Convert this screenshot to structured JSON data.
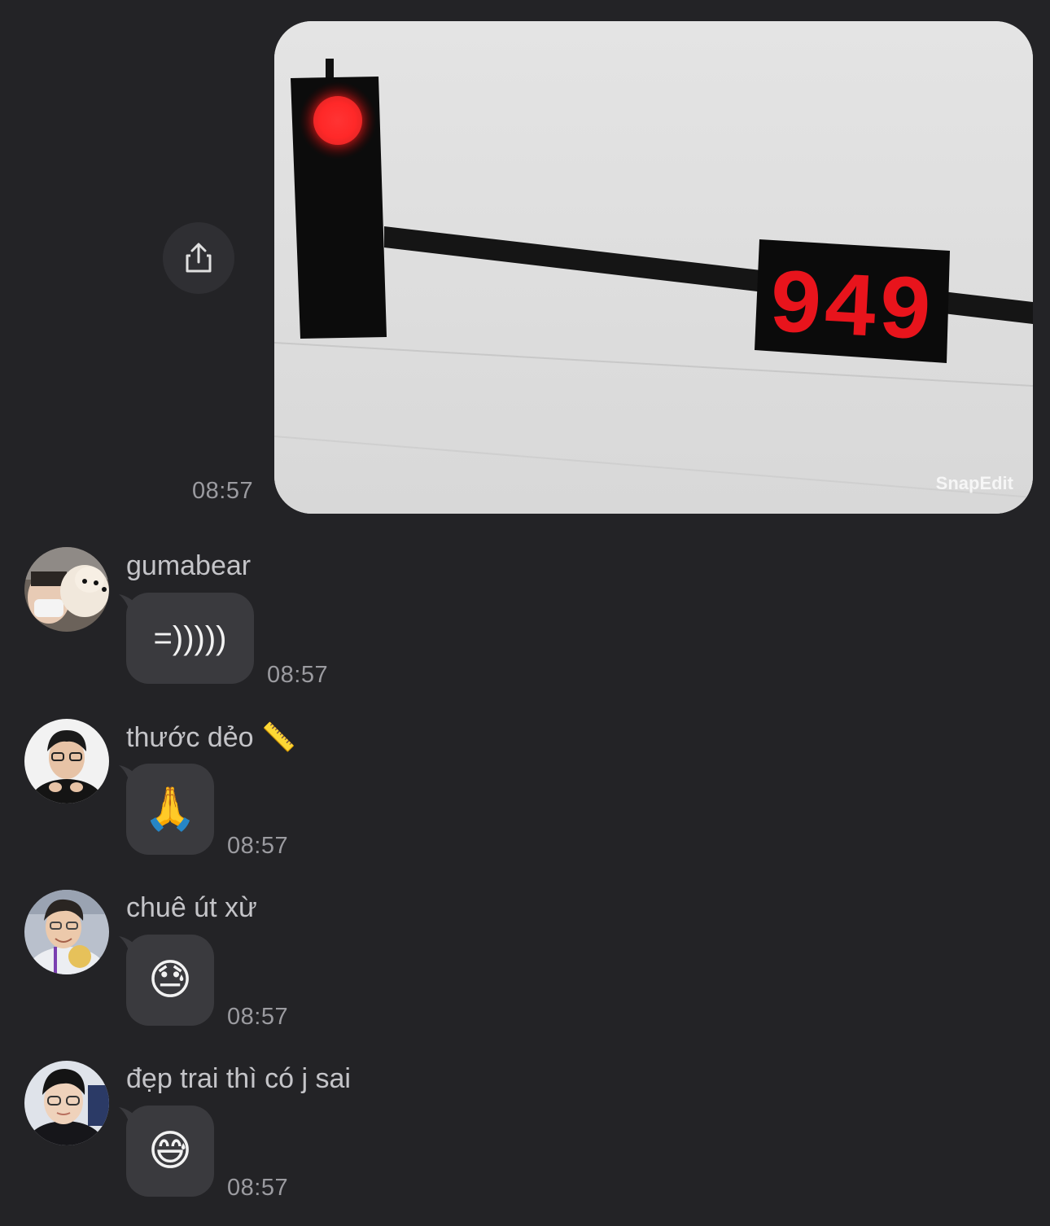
{
  "image_message": {
    "counter_display": "949",
    "watermark": "SnapEdit",
    "time": "08:57",
    "share_icon": "share-icon"
  },
  "messages": [
    {
      "sender": "gumabear",
      "text": "=)))))",
      "time": "08:57",
      "avatar": "avatar-person-with-dog"
    },
    {
      "sender": "thước dẻo 📏",
      "text": "🙏",
      "time": "08:57",
      "avatar": "avatar-person-glasses"
    },
    {
      "sender": "chuê út xừ",
      "text": "😓",
      "time": "08:57",
      "avatar": "avatar-person-smiling"
    },
    {
      "sender": "đẹp trai thì có j sai",
      "text": "😅",
      "time": "08:57",
      "avatar": "avatar-person-glasses-2"
    }
  ],
  "colors": {
    "background": "#232326",
    "bubble": "#3a3a3e",
    "timestamp": "#9b9ba0",
    "sender_name": "#c4c4c8",
    "traffic_light_red": "#ff2a2a",
    "counter_red": "#e8141c"
  }
}
